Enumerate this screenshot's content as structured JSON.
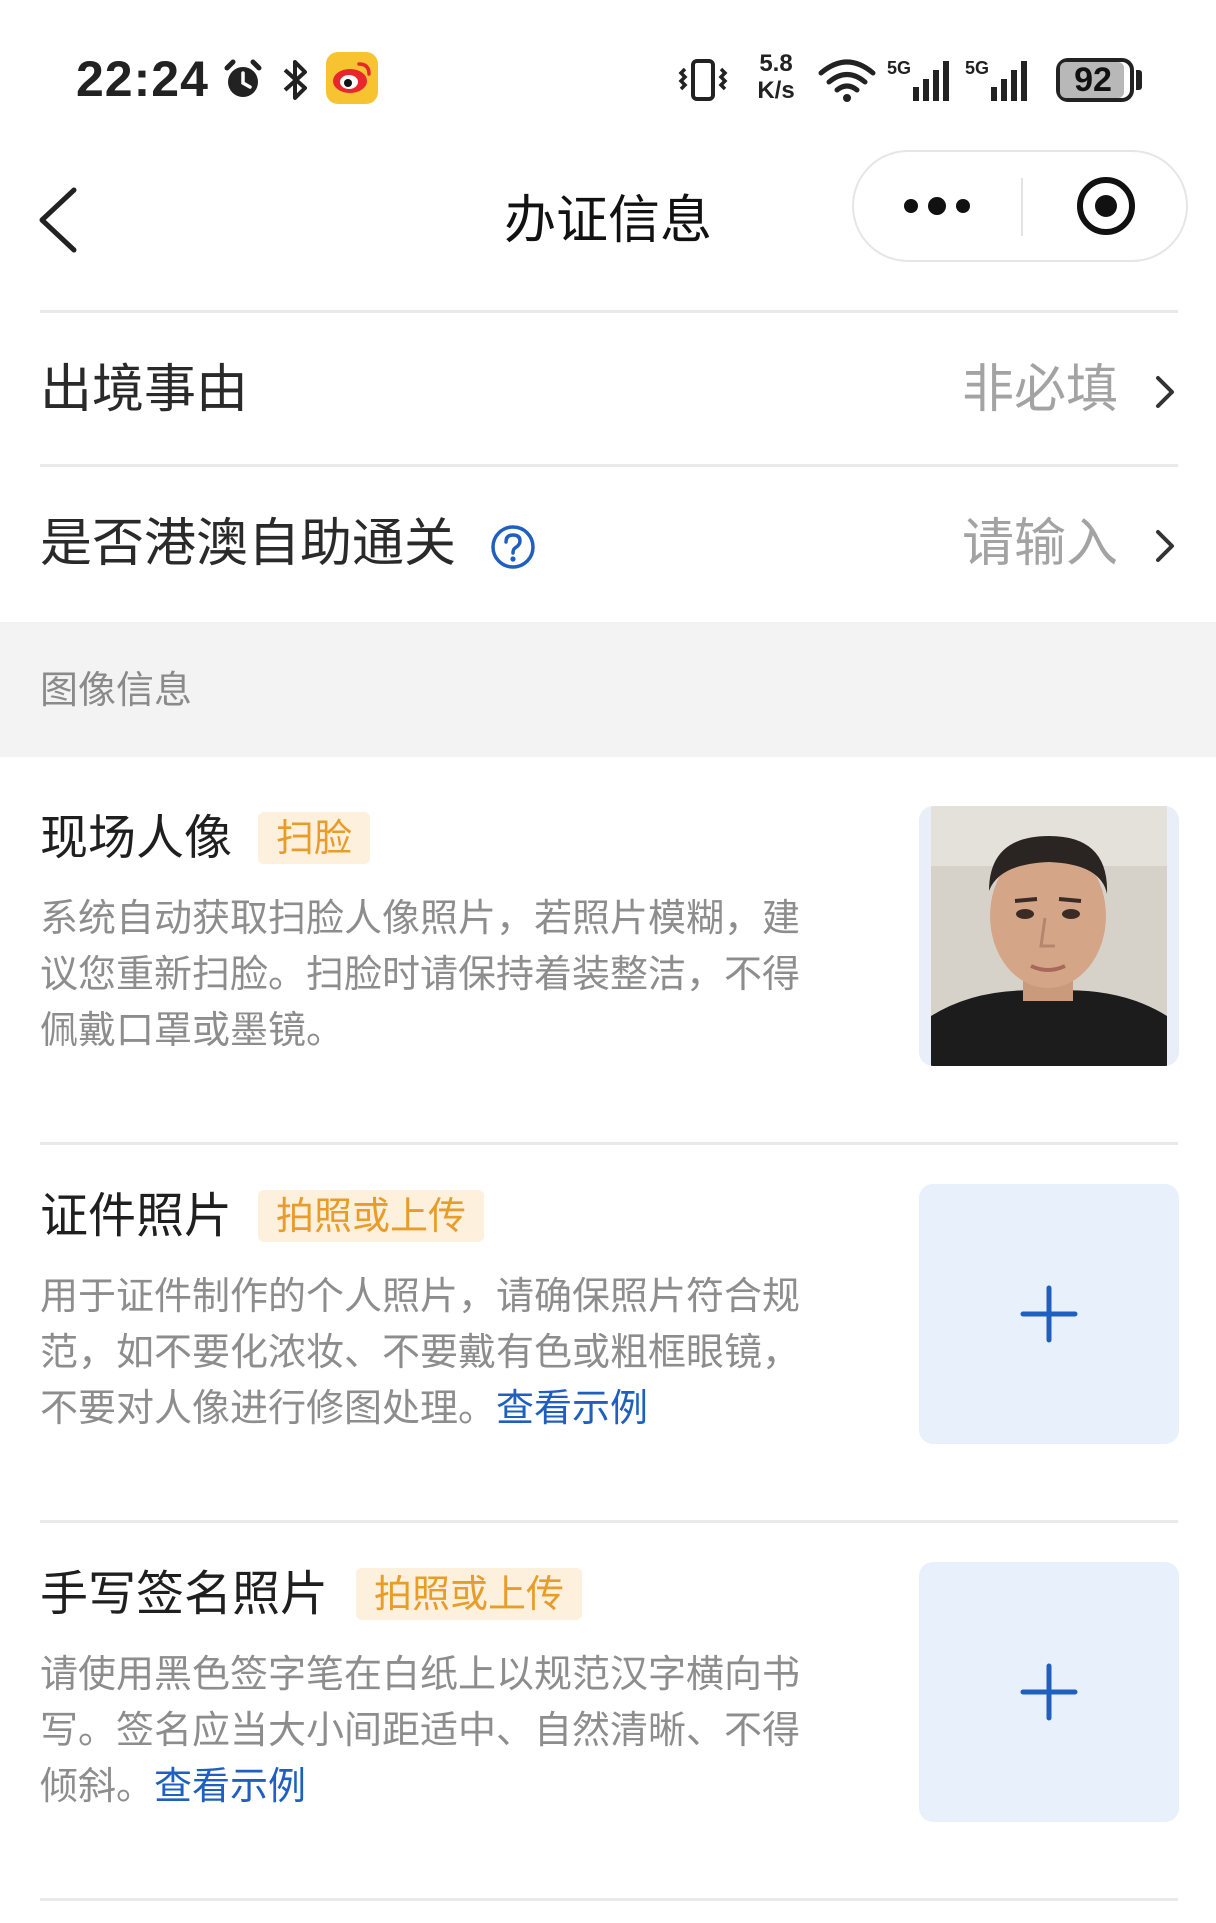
{
  "status_bar": {
    "time": "22:24",
    "net_speed_value": "5.8",
    "net_speed_unit": "K/s",
    "battery": "92",
    "icons": [
      "alarm-icon",
      "bluetooth-icon",
      "weibo-icon",
      "vibrate-icon",
      "wifi-icon",
      "signal-5g-icon",
      "signal-5g-icon"
    ]
  },
  "nav": {
    "title": "办证信息",
    "icons": [
      "back-icon",
      "more-icon",
      "close-miniprogram-icon"
    ]
  },
  "form": {
    "reason": {
      "label": "出境事由",
      "value": "非必填"
    },
    "self_service": {
      "label": "是否港澳自助通关",
      "value": "请输入"
    }
  },
  "section": {
    "title": "图像信息"
  },
  "items": [
    {
      "title": "现场人像",
      "tag": "扫脸",
      "desc": "系统自动获取扫脸人像照片，若照片模糊，建议您重新扫脸。扫脸时请保持着装整洁，不得佩戴口罩或墨镜。",
      "link": ""
    },
    {
      "title": "证件照片",
      "tag": "拍照或上传",
      "desc": "用于证件制作的个人照片，请确保照片符合规范，如不要化浓妆、不要戴有色或粗框眼镜，不要对人像进行修图处理。",
      "link": "查看示例"
    },
    {
      "title": "手写签名照片",
      "tag": "拍照或上传",
      "desc": "请使用黑色签字笔在白纸上以规范汉字横向书写。签名应当大小间距适中、自然清晰、不得倾斜。",
      "link": "查看示例"
    }
  ],
  "colors": {
    "accent_blue": "#1f5fbf",
    "tag_bg": "#fdf0dd",
    "tag_text": "#e89c2a",
    "upload_bg": "#e8f0fc",
    "section_bg": "#f3f3f3"
  }
}
